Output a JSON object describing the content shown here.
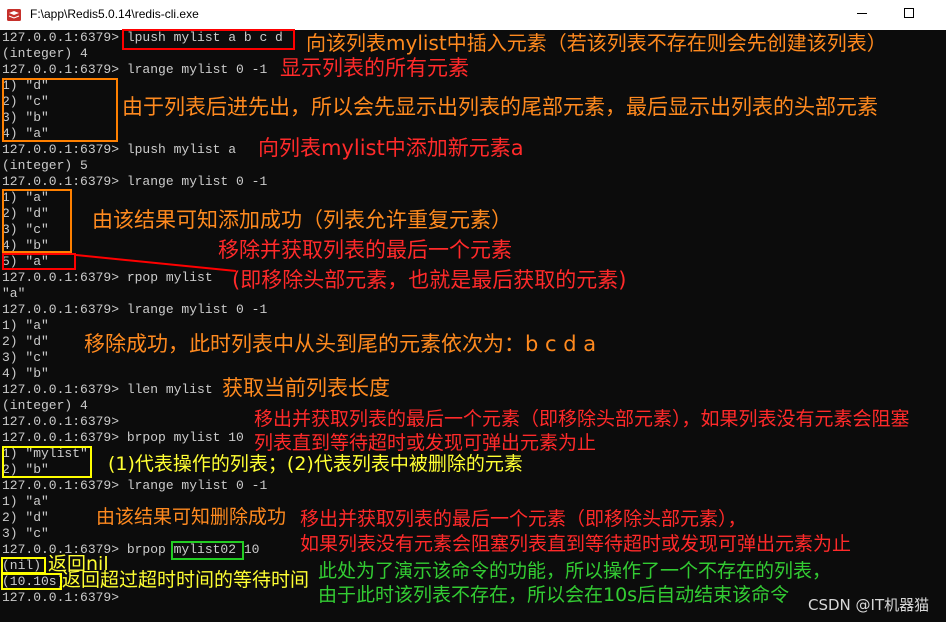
{
  "window": {
    "title": "F:\\app\\Redis5.0.14\\redis-cli.exe"
  },
  "icons": {
    "app": "redis-icon",
    "minimize": "minimize-icon",
    "maximize": "maximize-icon"
  },
  "terminal": {
    "lines": [
      "127.0.0.1:6379> lpush mylist a b c d",
      "(integer) 4",
      "127.0.0.1:6379> lrange mylist 0 -1",
      "1) \"d\"",
      "2) \"c\"",
      "3) \"b\"",
      "4) \"a\"",
      "127.0.0.1:6379> lpush mylist a",
      "(integer) 5",
      "127.0.0.1:6379> lrange mylist 0 -1",
      "1) \"a\"",
      "2) \"d\"",
      "3) \"c\"",
      "4) \"b\"",
      "5) \"a\"",
      "127.0.0.1:6379> rpop mylist",
      "\"a\"",
      "127.0.0.1:6379> lrange mylist 0 -1",
      "1) \"a\"",
      "2) \"d\"",
      "3) \"c\"",
      "4) \"b\"",
      "127.0.0.1:6379> llen mylist",
      "(integer) 4",
      "127.0.0.1:6379>",
      "127.0.0.1:6379> brpop mylist 10",
      "1) \"mylist\"",
      "2) \"b\"",
      "127.0.0.1:6379> lrange mylist 0 -1",
      "1) \"a\"",
      "2) \"d\"",
      "3) \"c\"",
      "127.0.0.1:6379> brpop mylist02 10",
      "(nil)",
      "(10.10s)",
      "127.0.0.1:6379>"
    ]
  },
  "annotations": {
    "orange": [
      "向该列表mylist中插入元素（若该列表不存在则会先创建该列表）",
      "由于列表后进先出，所以会先显示出列表的尾部元素，最后显示出列表的头部元素",
      "由该结果可知添加成功（列表允许重复元素）",
      "移除成功，此时列表中从头到尾的元素依次为：b c d a",
      "获取当前列表长度",
      "由该结果可知删除成功"
    ],
    "red": [
      "显示列表的所有元素",
      "向列表mylist中添加新元素a",
      "移除并获取列表的最后一个元素",
      "(即移除头部元素，也就是最后获取的元素)",
      "移出并获取列表的最后一个元素（即移除头部元素），如果列表没有元素会阻塞",
      "列表直到等待超时或发现可弹出元素为止",
      "移出并获取列表的最后一个元素（即移除头部元素），",
      "如果列表没有元素会阻塞列表直到等待超时或发现可弹出元素为止"
    ],
    "yellow": [
      "(1)代表操作的列表；(2)代表列表中被删除的元素",
      "返回nil",
      "返回超过超时时间的等待时间"
    ],
    "green": [
      "此处为了演示该命令的功能，所以操作了一个不存在的列表，",
      "由于此时该列表不存在，所以会在10s后自动结束该命令"
    ]
  },
  "watermark": "CSDN @IT机器猫",
  "colors": {
    "terminal_bg": "#0c0c0c",
    "terminal_text": "#cccccc",
    "annotation_orange": "#ff8a1f",
    "annotation_red": "#ff2a2a",
    "annotation_yellow": "#ffff33",
    "annotation_green": "#33cc33",
    "box_red": "#ff0000",
    "box_orange": "#ff8000",
    "box_yellow": "#ffff00",
    "box_green": "#22cc22",
    "watermark": "#d8d8d8"
  }
}
